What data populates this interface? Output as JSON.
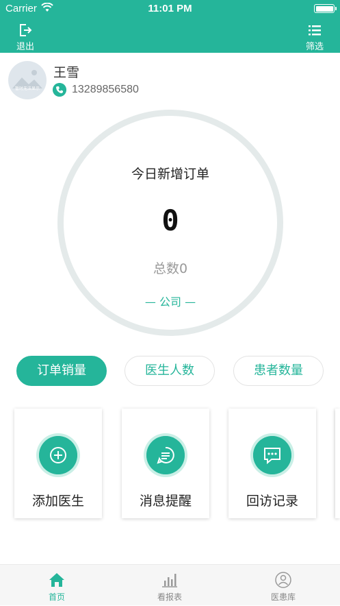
{
  "status_bar": {
    "carrier": "Carrier",
    "time": "11:01 PM"
  },
  "nav": {
    "exit_label": "退出",
    "filter_label": "筛选"
  },
  "user": {
    "name": "王雪",
    "phone": "13289856580",
    "avatar_caption": "暂时无法显示"
  },
  "summary": {
    "title": "今日新增订单",
    "count": "0",
    "total": "总数0",
    "scope": "— 公司 —"
  },
  "stat_tabs": [
    {
      "label": "订单销量",
      "active": true
    },
    {
      "label": "医生人数",
      "active": false
    },
    {
      "label": "患者数量",
      "active": false
    }
  ],
  "actions": [
    {
      "label": "添加医生",
      "icon": "plus-circle-icon"
    },
    {
      "label": "消息提醒",
      "icon": "message-icon"
    },
    {
      "label": "回访记录",
      "icon": "chat-dots-icon"
    }
  ],
  "tabbar": [
    {
      "label": "首页",
      "icon": "home-icon",
      "active": true
    },
    {
      "label": "看报表",
      "icon": "bar-chart-icon",
      "active": false
    },
    {
      "label": "医患库",
      "icon": "user-circle-icon",
      "active": false
    }
  ],
  "colors": {
    "brand": "#25b59a",
    "ring": "#e4eaea"
  }
}
